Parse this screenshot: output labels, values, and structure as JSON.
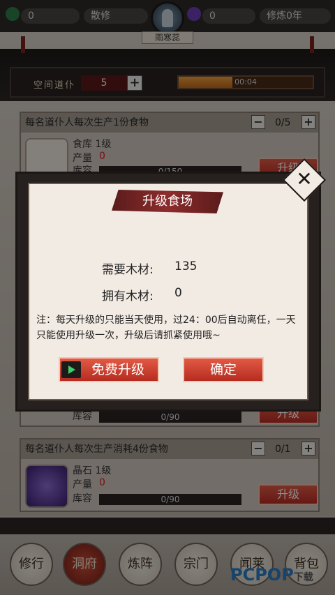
{
  "topbar": {
    "currency1": "0",
    "role": "散修",
    "currency2": "0",
    "cultivation": "修炼0年",
    "player_name": "雨寒蕊"
  },
  "hall": {
    "space_label": "空间道仆",
    "space_value": "5",
    "timer": "00:04"
  },
  "cards": [
    {
      "header": "每名道仆人每次生产1份食物",
      "count": "0/5",
      "name_line": "食库 1级",
      "output_label": "产量",
      "output_value": "0",
      "capacity_label": "库容",
      "capacity": "0/150",
      "upgrade": "升级"
    },
    {
      "capacity_label": "库容",
      "capacity": "0/90",
      "upgrade": "升级"
    },
    {
      "header": "每名道仆人每次生产消耗4份食物",
      "count": "0/1",
      "name_line": "晶石 1级",
      "output_label": "产量",
      "output_value": "0",
      "capacity_label": "库容",
      "capacity": "0/90",
      "upgrade": "升级"
    }
  ],
  "nav": [
    {
      "label": "修行"
    },
    {
      "label": "洞府"
    },
    {
      "label": "炼阵"
    },
    {
      "label": "宗门"
    },
    {
      "label": "闻莱"
    },
    {
      "label": "背包"
    }
  ],
  "watermark": {
    "logo": "PCPOP",
    "suffix": "下载"
  },
  "modal": {
    "title": "升级食场",
    "need_label": "需要木材:",
    "need_value": "135",
    "have_label": "拥有木材:",
    "have_value": "0",
    "note": "注：每天升级的只能当天使用，过24：00后自动离任，一天只能使用升级一次，升级后请抓紧使用哦~",
    "free_button": "免费升级",
    "confirm_button": "确定"
  },
  "colors": {
    "accent_red": "#d21f1f",
    "button_red": "#c8392b"
  }
}
